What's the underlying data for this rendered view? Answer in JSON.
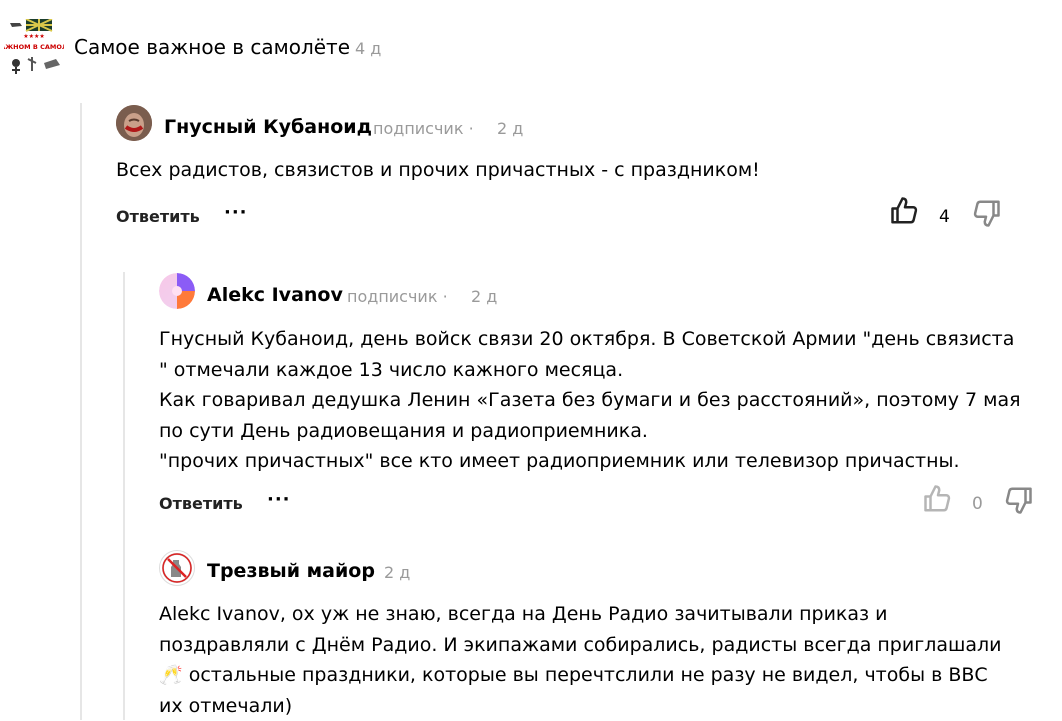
{
  "post": {
    "title": "Самое важное в самолёте",
    "time": "4 д",
    "logo_text": "О ВАЖНОМ В САМОЛЕТЕ"
  },
  "comments": [
    {
      "author": "Гнусный Кубаноид",
      "role": "подписчик ·",
      "time": "2 д",
      "text_lines": [
        "Всех радистов, связистов и прочих причастных - с праздником!"
      ],
      "reply_label": "Ответить",
      "more": "···",
      "likes": "4",
      "avatar_icon": "user-photo"
    },
    {
      "author": "Alekc Ivanov",
      "role": "подписчик ·",
      "time": "2 д",
      "text_lines": [
        "Гнусный Кубаноид, день войск связи 20 октября. В Советской Армии \"день связиста",
        "\" отмечали каждое 13 число кажного месяца.",
        "Как говаривал дедушка Ленин «Газета без бумаги и без расстояний», поэтому 7 мая",
        "по сути День радиовещания и радиоприемника.",
        "\"прочих причастных\" все кто имеет радиоприемник или телевизор причастны."
      ],
      "reply_label": "Ответить",
      "more": "···",
      "likes": "0",
      "avatar_icon": "gradient-avatar"
    },
    {
      "author": "Трезвый майор",
      "time": "2 д",
      "text_lines": [
        "Alekc Ivanov, ох уж не знаю, всегда на День Радио зачитывали приказ и",
        "поздравляли с Днём Радио. И экипажами собирались, радисты всегда приглашали",
        "🥂 остальные праздники, которые вы перечтслили не разу не видел, чтобы в ВВС",
        "их отмечали)"
      ],
      "avatar_icon": "no-drinking-sign"
    }
  ],
  "colors": {
    "muted": "#9a9a9a",
    "line": "#e6e6e6",
    "accent_like": "#222222",
    "disabled_like": "#b5b5b5"
  }
}
